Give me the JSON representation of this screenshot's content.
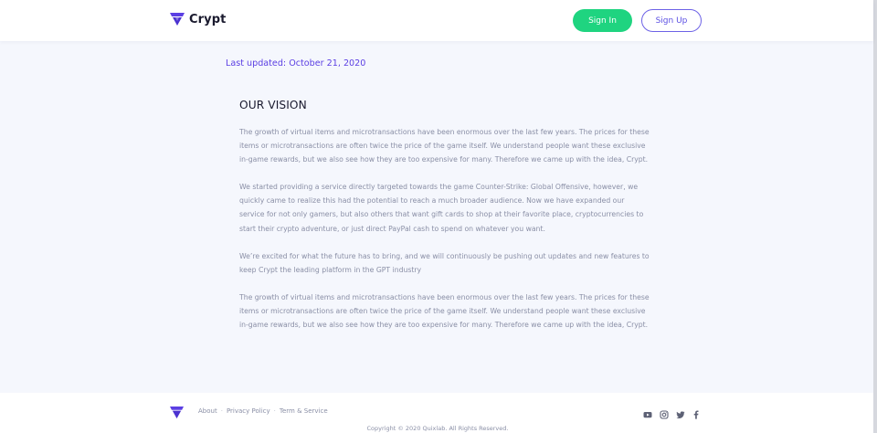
{
  "colors": {
    "accent": "#5b3fe3",
    "signin_bg": "#1fd480",
    "page_bg": "#f5f7fd",
    "body_text": "#8a8fa6"
  },
  "header": {
    "brand": "Crypt",
    "logo_icon": "crypt-logo-icon",
    "signin_label": "Sign In",
    "signup_label": "Sign Up"
  },
  "main": {
    "last_updated": "Last updated: October 21, 2020",
    "title": "OUR VISION",
    "paragraphs": [
      "The growth of virtual items and microtransactions have been enormous over the last few years. The prices for these items or microtransactions are often twice the price of the game itself. We understand people want these exclusive in-game rewards, but we also see how they are too expensive for many. Therefore we came up with the idea, Crypt.",
      "We started providing a service directly targeted towards the game Counter-Strike: Global Offensive, however, we quickly came to realize this had the potential to reach a much broader audience. Now we have expanded our service for not only gamers, but also others that want gift cards to shop at their favorite place, cryptocurrencies to start their crypto adventure, or just direct PayPal cash to spend on whatever you want.",
      "We’re excited for what the future has to bring, and we will continuously be pushing out updates and new features to keep Crypt the leading platform in the GPT industry",
      "The growth of virtual items and microtransactions have been enormous over the last few years. The prices for these items or microtransactions are often twice the price of the game itself. We understand people want these exclusive in-game rewards, but we also see how they are too expensive for many. Therefore we came up with the idea, Crypt."
    ]
  },
  "footer": {
    "links": [
      "About",
      "Privacy Policy",
      "Term & Service"
    ],
    "separator": "·",
    "social_icons": [
      "youtube-icon",
      "instagram-icon",
      "twitter-icon",
      "facebook-icon"
    ],
    "copyright": "Copyright © 2020 Quixlab. All Rights Reserved."
  }
}
